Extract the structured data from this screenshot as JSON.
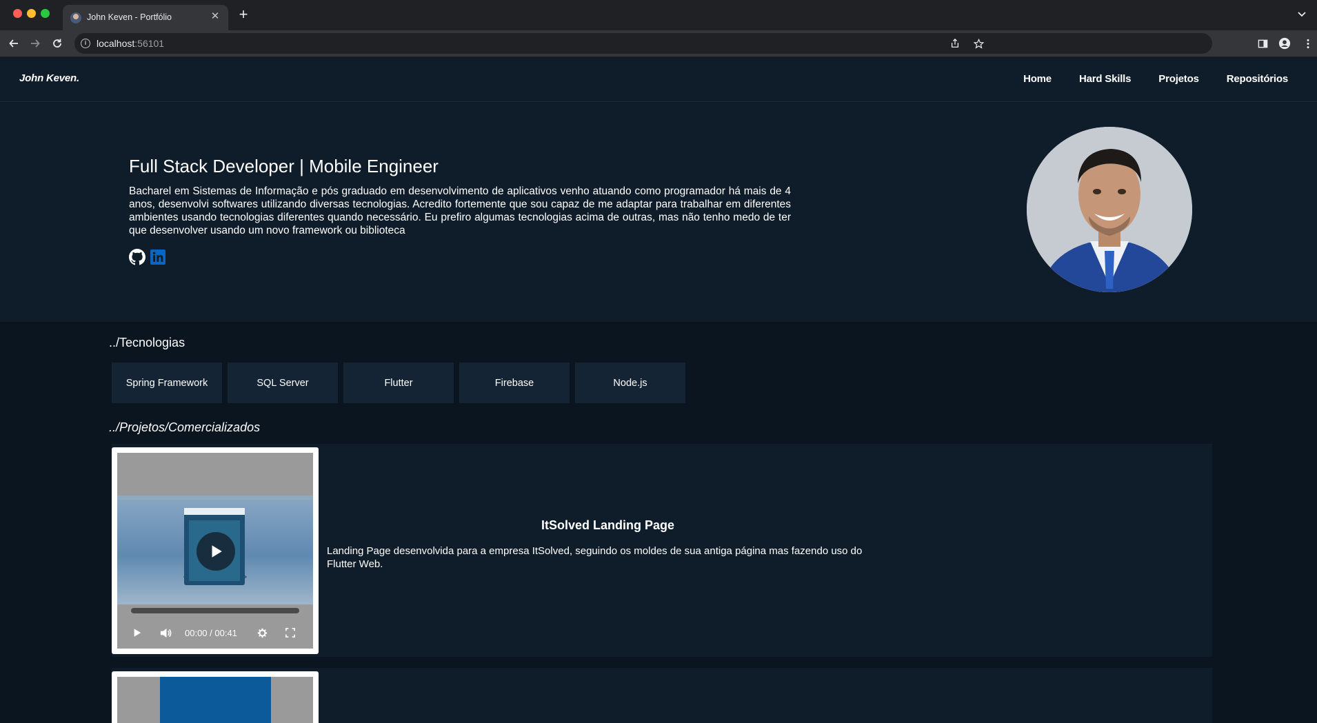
{
  "browser": {
    "tab_title": "John Keven - Portfólio",
    "url_host": "localhost",
    "url_port": ":56101"
  },
  "site": {
    "brand": "John Keven.",
    "nav": [
      "Home",
      "Hard Skills",
      "Projetos",
      "Repositórios"
    ]
  },
  "hero": {
    "title": "Full Stack Developer | Mobile Engineer",
    "description": "Bacharel em Sistemas de Informação e pós graduado em desenvolvimento de aplicativos venho atuando como programador há mais de 4 anos, desenvolvi softwares utilizando diversas tecnologias. Acredito fortemente que sou capaz de me adaptar para trabalhar em diferentes ambientes usando tecnologias diferentes quando necessário. Eu prefiro algumas tecnologias acima de outras, mas não tenho medo de ter que desenvolver usando um novo framework ou biblioteca",
    "social_icons": [
      "github-icon",
      "linkedin-icon"
    ]
  },
  "technologies": {
    "title": "../Tecnologias",
    "items": [
      "Spring Framework",
      "SQL Server",
      "Flutter",
      "Firebase",
      "Node.js"
    ]
  },
  "projects": {
    "title": "../Projetos/Comercializados",
    "items": [
      {
        "title": "ItSolved Landing Page",
        "description": "Landing Page desenvolvida para a empresa ItSolved, seguindo os moldes de sua antiga página mas fazendo uso do Flutter Web.",
        "video_time": "00:00 / 00:41"
      }
    ]
  },
  "colors": {
    "page_bg": "#0b1520",
    "panel_bg": "#0f1d2b",
    "card_bg": "#142435",
    "linkedin": "#0a66c2"
  }
}
